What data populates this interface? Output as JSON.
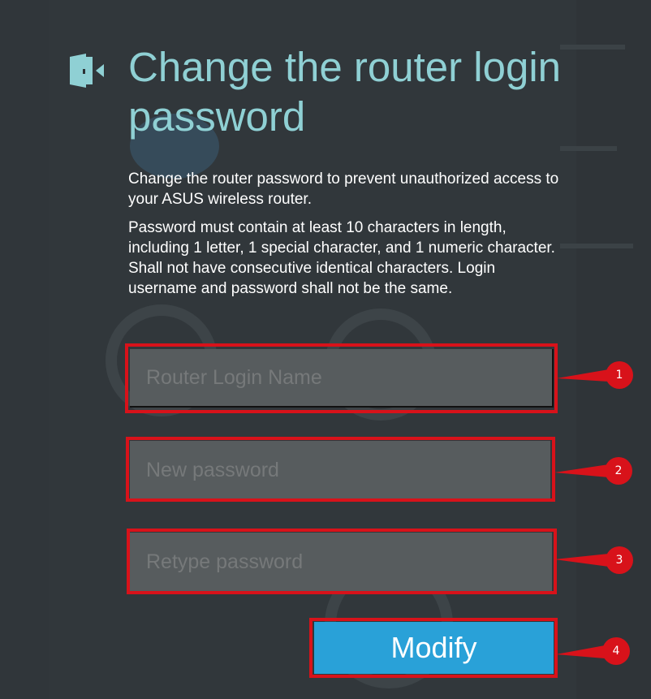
{
  "title": "Change the router login password",
  "description_1": "Change the router password to prevent unauthorized access to your ASUS wireless router.",
  "description_2": "Password must contain at least 10 characters in length, including 1 letter, 1 special character, and 1 numeric character. Shall not have consecutive identical characters. Login username and password shall not be the same.",
  "fields": {
    "login_name_placeholder": "Router Login Name",
    "new_password_placeholder": "New password",
    "retype_password_placeholder": "Retype password"
  },
  "modify_label": "Modify",
  "callouts": [
    "1",
    "2",
    "3",
    "4"
  ],
  "colors": {
    "title": "#8fd0d4",
    "button": "#29a1d8",
    "highlight": "#d8121a",
    "field": "#575c5e"
  },
  "icon": "door-exit-icon"
}
